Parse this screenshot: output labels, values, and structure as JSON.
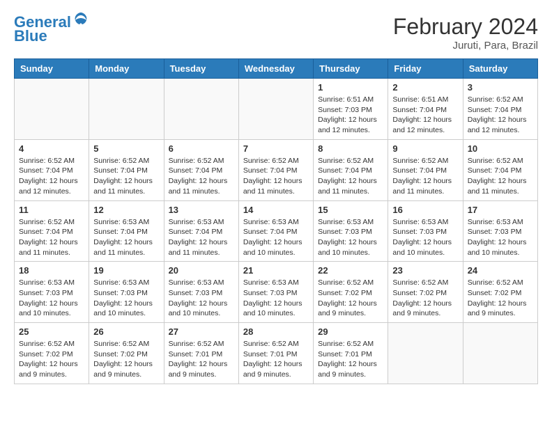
{
  "header": {
    "logo_line1": "General",
    "logo_line2": "Blue",
    "month_year": "February 2024",
    "location": "Juruti, Para, Brazil"
  },
  "weekdays": [
    "Sunday",
    "Monday",
    "Tuesday",
    "Wednesday",
    "Thursday",
    "Friday",
    "Saturday"
  ],
  "weeks": [
    [
      {
        "day": "",
        "info": ""
      },
      {
        "day": "",
        "info": ""
      },
      {
        "day": "",
        "info": ""
      },
      {
        "day": "",
        "info": ""
      },
      {
        "day": "1",
        "info": "Sunrise: 6:51 AM\nSunset: 7:03 PM\nDaylight: 12 hours\nand 12 minutes."
      },
      {
        "day": "2",
        "info": "Sunrise: 6:51 AM\nSunset: 7:04 PM\nDaylight: 12 hours\nand 12 minutes."
      },
      {
        "day": "3",
        "info": "Sunrise: 6:52 AM\nSunset: 7:04 PM\nDaylight: 12 hours\nand 12 minutes."
      }
    ],
    [
      {
        "day": "4",
        "info": "Sunrise: 6:52 AM\nSunset: 7:04 PM\nDaylight: 12 hours\nand 12 minutes."
      },
      {
        "day": "5",
        "info": "Sunrise: 6:52 AM\nSunset: 7:04 PM\nDaylight: 12 hours\nand 11 minutes."
      },
      {
        "day": "6",
        "info": "Sunrise: 6:52 AM\nSunset: 7:04 PM\nDaylight: 12 hours\nand 11 minutes."
      },
      {
        "day": "7",
        "info": "Sunrise: 6:52 AM\nSunset: 7:04 PM\nDaylight: 12 hours\nand 11 minutes."
      },
      {
        "day": "8",
        "info": "Sunrise: 6:52 AM\nSunset: 7:04 PM\nDaylight: 12 hours\nand 11 minutes."
      },
      {
        "day": "9",
        "info": "Sunrise: 6:52 AM\nSunset: 7:04 PM\nDaylight: 12 hours\nand 11 minutes."
      },
      {
        "day": "10",
        "info": "Sunrise: 6:52 AM\nSunset: 7:04 PM\nDaylight: 12 hours\nand 11 minutes."
      }
    ],
    [
      {
        "day": "11",
        "info": "Sunrise: 6:52 AM\nSunset: 7:04 PM\nDaylight: 12 hours\nand 11 minutes."
      },
      {
        "day": "12",
        "info": "Sunrise: 6:53 AM\nSunset: 7:04 PM\nDaylight: 12 hours\nand 11 minutes."
      },
      {
        "day": "13",
        "info": "Sunrise: 6:53 AM\nSunset: 7:04 PM\nDaylight: 12 hours\nand 11 minutes."
      },
      {
        "day": "14",
        "info": "Sunrise: 6:53 AM\nSunset: 7:04 PM\nDaylight: 12 hours\nand 10 minutes."
      },
      {
        "day": "15",
        "info": "Sunrise: 6:53 AM\nSunset: 7:03 PM\nDaylight: 12 hours\nand 10 minutes."
      },
      {
        "day": "16",
        "info": "Sunrise: 6:53 AM\nSunset: 7:03 PM\nDaylight: 12 hours\nand 10 minutes."
      },
      {
        "day": "17",
        "info": "Sunrise: 6:53 AM\nSunset: 7:03 PM\nDaylight: 12 hours\nand 10 minutes."
      }
    ],
    [
      {
        "day": "18",
        "info": "Sunrise: 6:53 AM\nSunset: 7:03 PM\nDaylight: 12 hours\nand 10 minutes."
      },
      {
        "day": "19",
        "info": "Sunrise: 6:53 AM\nSunset: 7:03 PM\nDaylight: 12 hours\nand 10 minutes."
      },
      {
        "day": "20",
        "info": "Sunrise: 6:53 AM\nSunset: 7:03 PM\nDaylight: 12 hours\nand 10 minutes."
      },
      {
        "day": "21",
        "info": "Sunrise: 6:53 AM\nSunset: 7:03 PM\nDaylight: 12 hours\nand 10 minutes."
      },
      {
        "day": "22",
        "info": "Sunrise: 6:52 AM\nSunset: 7:02 PM\nDaylight: 12 hours\nand 9 minutes."
      },
      {
        "day": "23",
        "info": "Sunrise: 6:52 AM\nSunset: 7:02 PM\nDaylight: 12 hours\nand 9 minutes."
      },
      {
        "day": "24",
        "info": "Sunrise: 6:52 AM\nSunset: 7:02 PM\nDaylight: 12 hours\nand 9 minutes."
      }
    ],
    [
      {
        "day": "25",
        "info": "Sunrise: 6:52 AM\nSunset: 7:02 PM\nDaylight: 12 hours\nand 9 minutes."
      },
      {
        "day": "26",
        "info": "Sunrise: 6:52 AM\nSunset: 7:02 PM\nDaylight: 12 hours\nand 9 minutes."
      },
      {
        "day": "27",
        "info": "Sunrise: 6:52 AM\nSunset: 7:01 PM\nDaylight: 12 hours\nand 9 minutes."
      },
      {
        "day": "28",
        "info": "Sunrise: 6:52 AM\nSunset: 7:01 PM\nDaylight: 12 hours\nand 9 minutes."
      },
      {
        "day": "29",
        "info": "Sunrise: 6:52 AM\nSunset: 7:01 PM\nDaylight: 12 hours\nand 9 minutes."
      },
      {
        "day": "",
        "info": ""
      },
      {
        "day": "",
        "info": ""
      }
    ]
  ]
}
